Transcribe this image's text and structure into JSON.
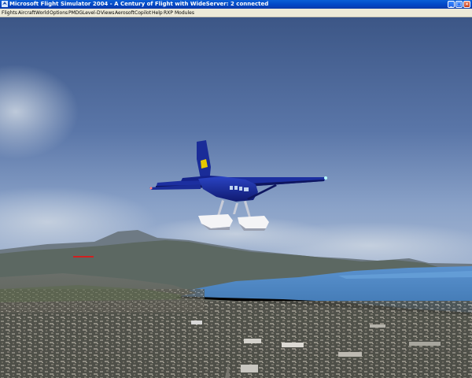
{
  "window": {
    "title": "Microsoft Flight Simulator 2004 - A Century of Flight with WideServer: 2 connected",
    "controls": [
      "minimize",
      "maximize",
      "close"
    ]
  },
  "menu": {
    "items": [
      {
        "label": "Flights"
      },
      {
        "label": "Aircraft"
      },
      {
        "label": "World"
      },
      {
        "label": "Options"
      },
      {
        "label": "PMDG"
      },
      {
        "label": "Level-D"
      },
      {
        "label": "Views"
      },
      {
        "label": "Aerosoft"
      },
      {
        "label": "Copilot"
      },
      {
        "label": "Help"
      },
      {
        "label": "RXP"
      },
      {
        "label": "Modules"
      }
    ]
  },
  "colors": {
    "sky_top": "#3f5a8c",
    "sky_bottom": "#7f99c4",
    "aircraft_blue": "#1c2fa0",
    "floats": "#ffffff",
    "sea": "#4a88c8"
  }
}
